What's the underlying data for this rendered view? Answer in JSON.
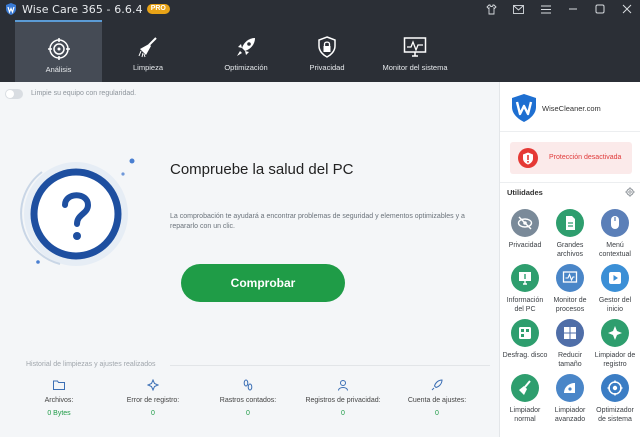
{
  "window": {
    "title": "Wise Care 365 - 6.6.4",
    "badge": "PRO",
    "controls": [
      "shirt-icon",
      "mail-icon",
      "menu-icon",
      "minimize-icon",
      "maximize-icon",
      "close-icon"
    ]
  },
  "nav": {
    "items": [
      {
        "label": "Análisis",
        "icon": "target-icon",
        "active": true
      },
      {
        "label": "Limpieza",
        "icon": "broom-icon",
        "active": false
      },
      {
        "label": "Optimización",
        "icon": "rocket-icon",
        "active": false
      },
      {
        "label": "Privacidad",
        "icon": "lock-shield-icon",
        "active": false
      },
      {
        "label": "Monitor del sistema",
        "icon": "monitor-icon",
        "active": false
      }
    ]
  },
  "main": {
    "toggle_label": "Limpie su equipo con regularidad.",
    "toggle_on": false,
    "headline": "Compruebe la salud del PC",
    "description": "La comprobación te ayudará a encontrar problemas de seguridad y elementos optimizables y a repararlo con un clic.",
    "check_button": "Comprobar",
    "history_label": "Historial de limpiezas y ajustes realizados",
    "stats": [
      {
        "label": "Archivos:",
        "value": "0 Bytes",
        "icon": "folder-icon"
      },
      {
        "label": "Error de registro:",
        "value": "0",
        "icon": "registry-icon"
      },
      {
        "label": "Rastros contados:",
        "value": "0",
        "icon": "footprints-icon"
      },
      {
        "label": "Registros de privacidad:",
        "value": "0",
        "icon": "user-icon"
      },
      {
        "label": "Cuenta de ajustes:",
        "value": "0",
        "icon": "rocket-small-icon"
      }
    ]
  },
  "sidebar": {
    "brand": "WiseCleaner.com",
    "protection": "Protección desactivada",
    "utilities_title": "Utilidades",
    "tools": [
      {
        "label": "Privacidad",
        "icon": "eye-slash-icon",
        "color": "#7a8a99"
      },
      {
        "label": "Grandes archivos",
        "icon": "large-files-icon",
        "color": "#2e9e6e"
      },
      {
        "label": "Menú contextual",
        "icon": "mouse-icon",
        "color": "#5b7fb8"
      },
      {
        "label": "Información del PC",
        "icon": "pc-info-icon",
        "color": "#2e9e6e"
      },
      {
        "label": "Monitor de procesos",
        "icon": "process-monitor-icon",
        "color": "#4a86c8"
      },
      {
        "label": "Gestor del inicio",
        "icon": "play-icon",
        "color": "#3b8fd6"
      },
      {
        "label": "Desfrag. disco",
        "icon": "disk-icon",
        "color": "#2e9e6e"
      },
      {
        "label": "Reducir tamaño",
        "icon": "windows-icon",
        "color": "#4f6ea8"
      },
      {
        "label": "Limpiador de registro",
        "icon": "registry-cleaner-icon",
        "color": "#2e9e6e"
      },
      {
        "label": "Limpiador normal",
        "icon": "brush-icon",
        "color": "#2e9e6e"
      },
      {
        "label": "Limpiador avanzado",
        "icon": "advanced-cleaner-icon",
        "color": "#4a86c8"
      },
      {
        "label": "Optimizador de sistema",
        "icon": "optimizer-icon",
        "color": "#3b7dc4"
      }
    ]
  },
  "colors": {
    "accent_green": "#1f9c47",
    "accent_blue": "#1e4fa0",
    "danger": "#e53935",
    "titlebar": "#2b2f36"
  }
}
